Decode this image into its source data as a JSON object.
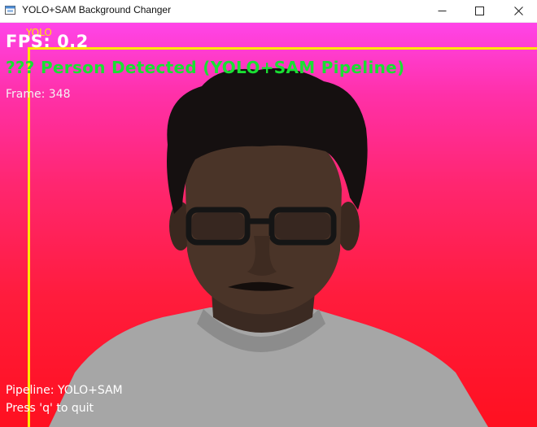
{
  "window": {
    "title": "YOLO+SAM Background Changer",
    "icon": "window-app-icon"
  },
  "overlay": {
    "bbox_label": "YOLO",
    "fps": "FPS: 0.2",
    "status": "??? Person Detected (YOLO+SAM Pipeline)",
    "frame": "Frame: 348",
    "pipeline": "Pipeline: YOLO+SAM",
    "quit_hint": "Press 'q' to quit"
  },
  "colors": {
    "background_top": "#ff44e8",
    "background_bottom": "#ff1020",
    "bbox": "#ffe600",
    "status_text": "#19e033",
    "overlay_text": "#ffffff"
  }
}
